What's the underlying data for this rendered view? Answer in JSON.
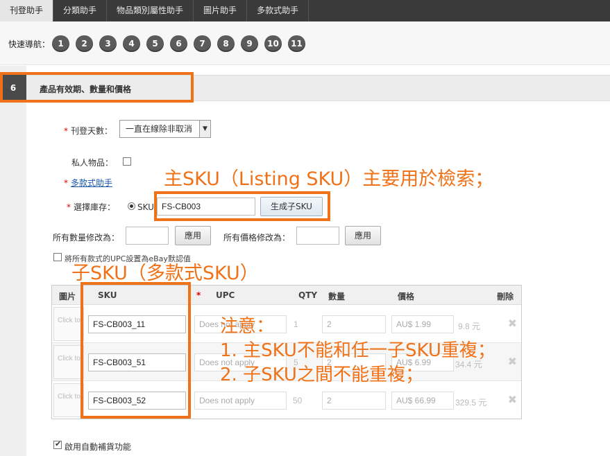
{
  "tabs": [
    {
      "label": "刊登助手",
      "active": true
    },
    {
      "label": "分類助手",
      "active": false
    },
    {
      "label": "物品類別屬性助手",
      "active": false
    },
    {
      "label": "圖片助手",
      "active": false
    },
    {
      "label": "多款式助手",
      "active": false
    }
  ],
  "quicknav": {
    "label": "快速導航：",
    "numbers": [
      "1",
      "2",
      "3",
      "4",
      "5",
      "6",
      "7",
      "8",
      "9",
      "10",
      "11"
    ]
  },
  "section": {
    "number": "6",
    "title": "產品有效期、數量和價格"
  },
  "form": {
    "duration_label": "刊登天數：",
    "duration_value": "一直在線除非取消",
    "private_label": "私人物品：",
    "variation_link": "多款式助手",
    "inventory_label": "選擇庫存：",
    "sku_radio_label": "SKU",
    "sku_value": "FS-CB003",
    "gen_sku_button": "生成子SKU",
    "all_qty_label": "所有數量修改為：",
    "all_price_label": "所有價格修改為：",
    "apply_label": "應用",
    "upc_default_label": "將所有款式的UPC設置為eBay默認值",
    "auto_restock_label": "啟用自動補貨功能"
  },
  "grid": {
    "headers": {
      "image": "圖片",
      "sku": "SKU",
      "upc_star": "*",
      "upc": "UPC",
      "qty": "QTY",
      "quantity": "數量",
      "price": "價格",
      "delete": "刪除"
    },
    "rows": [
      {
        "img": "Click to change",
        "sku": "FS-CB003_11",
        "upc": "Does not apply",
        "qty": "1",
        "quantity": "2",
        "price": "AU$ 1.99",
        "converted": "9.8 元"
      },
      {
        "img": "Click to change",
        "sku": "FS-CB003_51",
        "upc": "Does not apply",
        "qty": "5",
        "quantity": "2",
        "price": "AU$ 6.99",
        "converted": "34.4 元"
      },
      {
        "img": "Click to change",
        "sku": "FS-CB003_52",
        "upc": "Does not apply",
        "qty": "50",
        "quantity": "2",
        "price": "AU$ 66.99",
        "converted": "329.5 元"
      }
    ]
  },
  "annotations": {
    "main_sku": "主SKU（Listing SKU）主要用於檢索；",
    "child_sku": "子SKU（多款式SKU）",
    "note_title": "注意：",
    "note_1": "1. 主SKU不能和任一子SKU重複；",
    "note_2": "2. 子SKU之間不能重複；"
  },
  "colors": {
    "annotation": "#f07218",
    "tabbar": "#3a3a3a"
  }
}
